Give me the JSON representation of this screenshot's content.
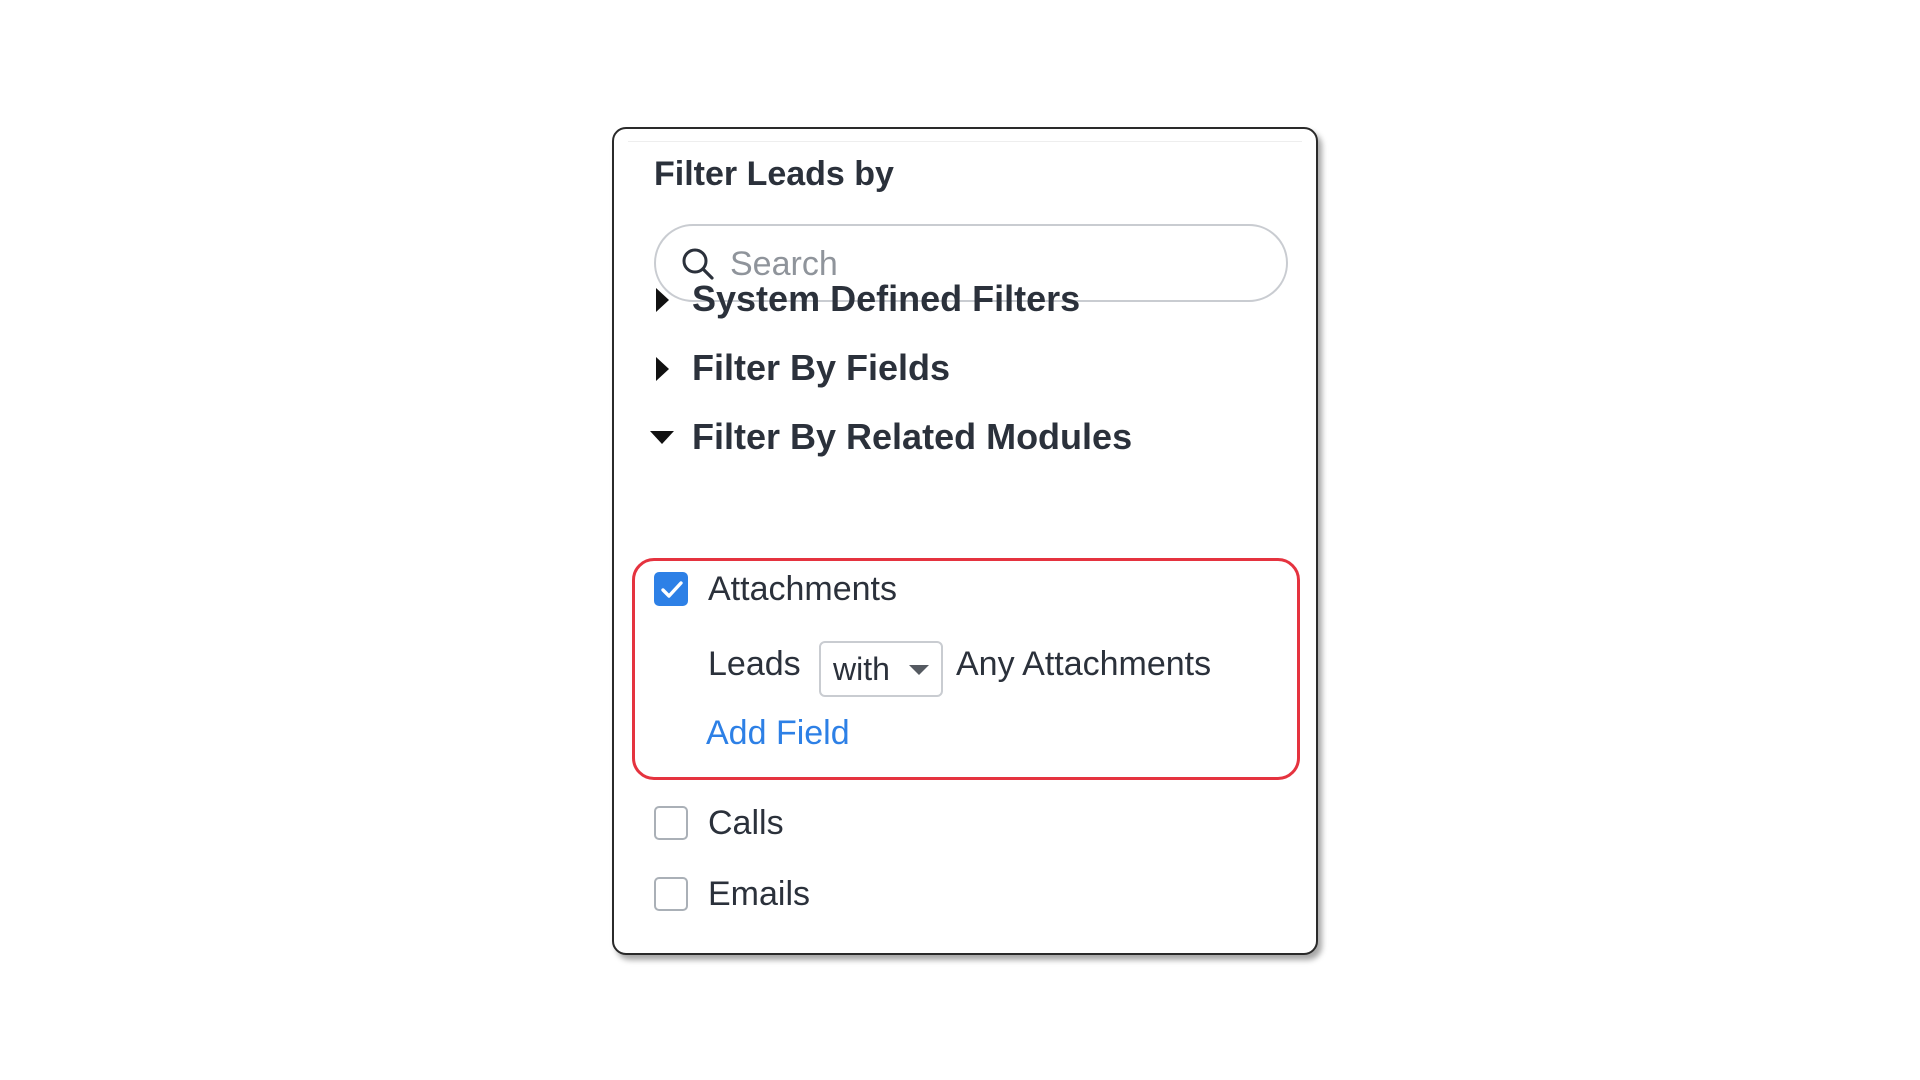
{
  "panel": {
    "title": "Filter Leads by",
    "search": {
      "placeholder": "Search",
      "value": ""
    },
    "sections": [
      {
        "label": "System Defined Filters",
        "expanded": false
      },
      {
        "label": "Filter By Fields",
        "expanded": false
      },
      {
        "label": "Filter By Related Modules",
        "expanded": true
      }
    ],
    "modules": {
      "attachments": {
        "label": "Attachments",
        "checked": true,
        "condition": {
          "prefix": "Leads",
          "operator": "with",
          "suffix": "Any Attachments"
        },
        "add_field": "Add Field"
      },
      "calls": {
        "label": "Calls",
        "checked": false
      },
      "emails": {
        "label": "Emails",
        "checked": false
      }
    }
  },
  "colors": {
    "accent": "#2d80e6",
    "highlight_border": "#e5333f",
    "text": "#2b313b",
    "placeholder": "#8f949b"
  },
  "icons": {
    "search": "search-icon",
    "collapsed": "caret-right-icon",
    "expanded": "caret-down-icon",
    "checkmark": "checkmark-icon",
    "dropdown": "dropdown-caret-icon"
  }
}
